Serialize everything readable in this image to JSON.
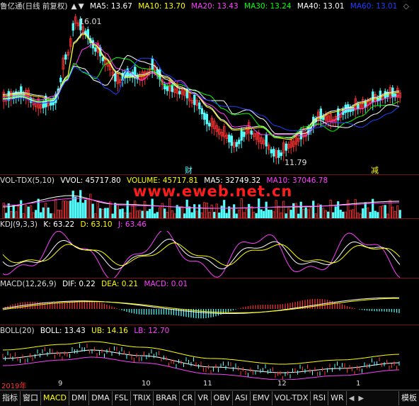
{
  "colors": {
    "ma5": "#ffffff",
    "ma10": "#ffff00",
    "ma20": "#ff40ff",
    "ma30": "#00ff00",
    "ma40": "#ffffff",
    "ma60": "#2040ff",
    "up": "#ff3232",
    "down": "#54ffff",
    "kdj_k": "#ffffff",
    "kdj_d": "#ffff00",
    "kdj_j": "#ff40ff",
    "watermark": "#ff1c1c"
  },
  "main": {
    "title": "鲁亿通(日线 前复权)",
    "ma5": "MA5: 13.67",
    "ma10": "MA10: 13.70",
    "ma20": "MA20: 13.43",
    "ma30": "MA30: 13.24",
    "ma40": "MA40: 13.01",
    "ma60": "MA60: 13.01",
    "high_label": "16.01",
    "low_label": "11.79",
    "marker_cai": "财",
    "marker_jian": "减",
    "arrow_up": "▲",
    "arrow_down": "▼",
    "diamond": "◇"
  },
  "vol": {
    "title": "VOL-TDX(5,10)",
    "vvol": "VVOL: 45717.80",
    "volume": "VOLUME: 45717.81",
    "ma5": "MA5: 32749.32",
    "ma10": "MA10: 37046.78"
  },
  "watermark": "www.eweb.net.cn",
  "kdj": {
    "title": "KDJ(9,3,3)",
    "k": "K: 63.22",
    "d": "D: 63.10",
    "j": "J: 63.46"
  },
  "macd": {
    "title": "MACD(12,26,9)",
    "dif": "DIF: 0.22",
    "dea": "DEA: 0.21",
    "macd": "MACD: 0.01"
  },
  "boll": {
    "title": "BOLL(20)",
    "boll": "BOLL: 13.43",
    "ub": "UB: 14.16",
    "lb": "LB: 12.70"
  },
  "axis": {
    "year": "2019年",
    "m9": "9",
    "m10": "10",
    "m11": "11",
    "m12": "12",
    "m1": "1"
  },
  "tabs": [
    "指标",
    "窗口",
    "MACD",
    "DMI",
    "DMA",
    "FSL",
    "TRIX",
    "BRAR",
    "CR",
    "VR",
    "OBV",
    "ASI",
    "EMV",
    "VOL-TDX",
    "RSI",
    "WR"
  ],
  "controls": {
    "prev": "◀",
    "next": "▶",
    "template": "模板"
  }
}
